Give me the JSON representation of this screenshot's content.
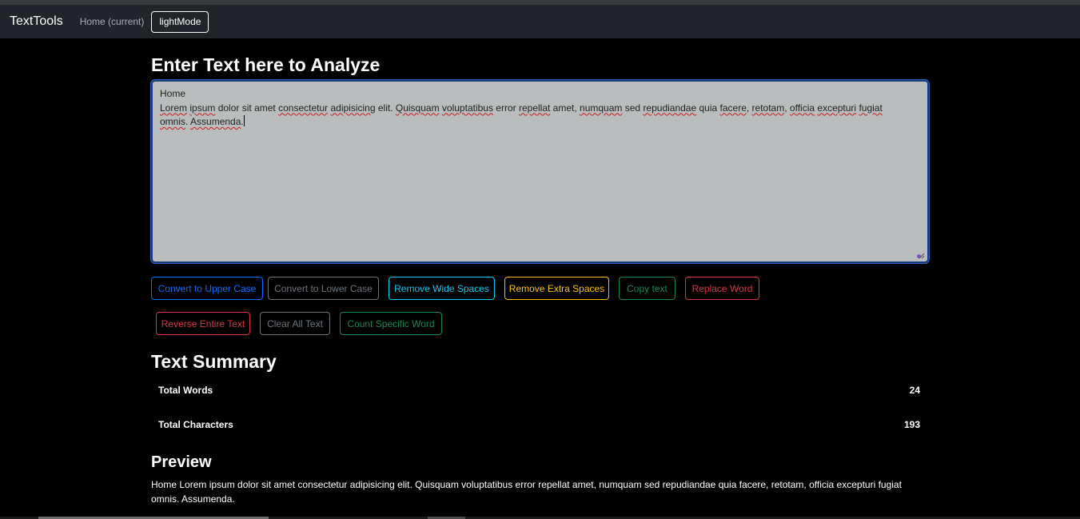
{
  "navbar": {
    "brand": "TextTools",
    "home_link": "Home (current)",
    "mode_button": "lightMode"
  },
  "main": {
    "title": "Enter Text here to Analyze",
    "textarea": {
      "line1": "Home",
      "line2_words": [
        "Lorem",
        " ",
        "ipsum",
        " dolor sit ",
        "amet",
        " ",
        "consectetur",
        " ",
        "adipisicing",
        " elit. ",
        "Quisquam",
        " ",
        "voluptatibus",
        " error ",
        "repellat",
        " amet, ",
        "numquam",
        " sed ",
        "repudiandae",
        " quia ",
        "facere",
        ", ",
        "retotam",
        ", ",
        "officia",
        " ",
        "excepturi",
        " ",
        "fugiat"
      ],
      "line3_words": [
        "omnis",
        ". ",
        "Assumenda",
        "."
      ]
    },
    "buttons": [
      {
        "label": "Convert to Upper Case",
        "color": "#0d6efd"
      },
      {
        "label": "Convert to Lower Case",
        "color": "#6c757d"
      },
      {
        "label": "Remove Wide Spaces",
        "color": "#0dcaf0"
      },
      {
        "label": "Remove Extra Spaces",
        "color": "#ffc107"
      },
      {
        "label": "Copy text",
        "color": "#198754"
      },
      {
        "label": "Replace Word",
        "color": "#dc3545"
      },
      {
        "label": "Reverse Entire Text",
        "color": "#dc3545"
      },
      {
        "label": "Clear All Text",
        "color": "#6c757d"
      },
      {
        "label": "Count Specific Word",
        "color": "#198754"
      }
    ]
  },
  "summary": {
    "title": "Text Summary",
    "rows": [
      {
        "label": "Total Words",
        "value": "24"
      },
      {
        "label": "Total Characters",
        "value": "193"
      }
    ]
  },
  "preview": {
    "title": "Preview",
    "text": "Home Lorem ipsum dolor sit amet consectetur adipisicing elit. Quisquam voluptatibus error repellat amet, numquam sed repudiandae quia facere, retotam, officia excepturi fugiat omnis. Assumenda."
  }
}
